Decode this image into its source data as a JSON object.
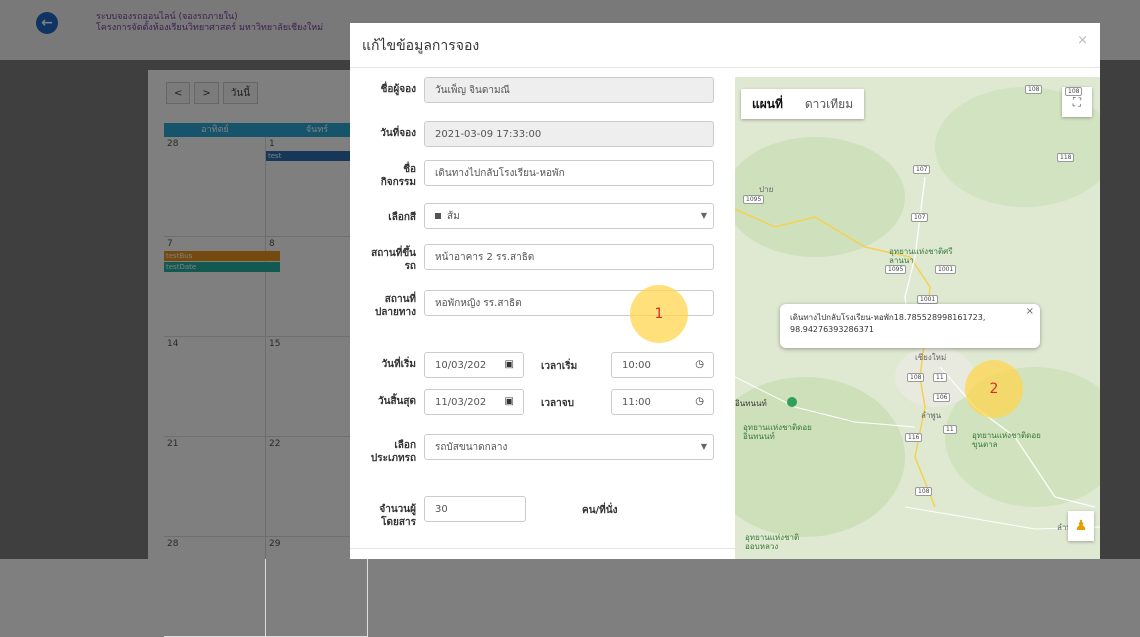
{
  "app": {
    "header_line1": "ระบบจองรถออนไลน์ (จองรถภายใน)",
    "header_line2": "โครงการจัดตั้งห้องเรียนวิทยาศาสตร์ มหาวิทยาลัยเชียงใหม่"
  },
  "calendar": {
    "prev_label": "<",
    "next_label": ">",
    "day_label": "วันนี้",
    "headers": [
      "อาทิตย์",
      "จันทร์"
    ],
    "dates": [
      [
        "28",
        "1"
      ],
      [
        "7",
        "8"
      ],
      [
        "14",
        "15"
      ],
      [
        "21",
        "22"
      ],
      [
        "28",
        "29"
      ]
    ],
    "events": [
      {
        "text": "test",
        "color": "#2f6fb0"
      },
      {
        "text": "testBus",
        "color": "#e8941d"
      },
      {
        "text": "testDate",
        "color": "#23b3a3"
      }
    ]
  },
  "modal": {
    "title": "แก้ไขข้อมูลการจอง",
    "close": "×",
    "fields": {
      "booker_label": "ชื่อผู้จอง",
      "booker_value": "วันเพ็ญ จินดามณี",
      "booking_date_label": "วันที่จอง",
      "booking_date_value": "2021-03-09 17:33:00",
      "activity_label": "ชื่อกิจกรรม",
      "activity_value": "เดินทางไปกลับโรงเรียน-หอพัก",
      "color_label": "เลือกสี",
      "color_value": "ส้ม",
      "pickup_label": "สถานที่ขึ้นรถ",
      "pickup_value": "หน้าอาคาร 2 รร.สาธิต",
      "destination_label": "สถานที่ปลายทาง",
      "destination_value": "หอพักหญิง รร.สาธิต",
      "start_date_label": "วันที่เริ่ม",
      "start_date_value": "10/03/202",
      "start_time_label": "เวลาเริ่ม",
      "start_time_value": "10:00",
      "end_date_label": "วันสิ้นสุด",
      "end_date_value": "11/03/202",
      "end_time_label": "เวลาจบ",
      "end_time_value": "11:00",
      "vehicle_label": "เลือกประเภทรถ",
      "vehicle_value": "รถบัสขนาดกลาง",
      "passengers_label": "จำนวนผู้โดยสาร",
      "passengers_value": "30",
      "passengers_unit": "คน/ที่นั่ง"
    }
  },
  "map": {
    "tab_map": "แผนที่",
    "tab_satellite": "ดาวเทียม",
    "info_text": "เดินทางไปกลับโรงเรียน-หอพัก18.785528998161723, 98.94276393286371",
    "places": [
      "อุทยานแห่งชาติศรีลานนา",
      "เชียงใหม่",
      "ลำพูน",
      "อุทยานแห่งชาติดอยอินทนนท์",
      "อุทยานแห่งชาติดอยขุนตาล",
      "อุทยานแห่งชาติออบหลวง",
      "ลำปาง",
      "ปาย",
      "อินทนนท์"
    ],
    "roads": [
      "108",
      "107",
      "118",
      "1095",
      "107",
      "1095",
      "1001",
      "1001",
      "108",
      "11",
      "106",
      "11",
      "116",
      "108",
      "108"
    ]
  },
  "annotations": {
    "marker1": "1",
    "marker2": "2"
  }
}
